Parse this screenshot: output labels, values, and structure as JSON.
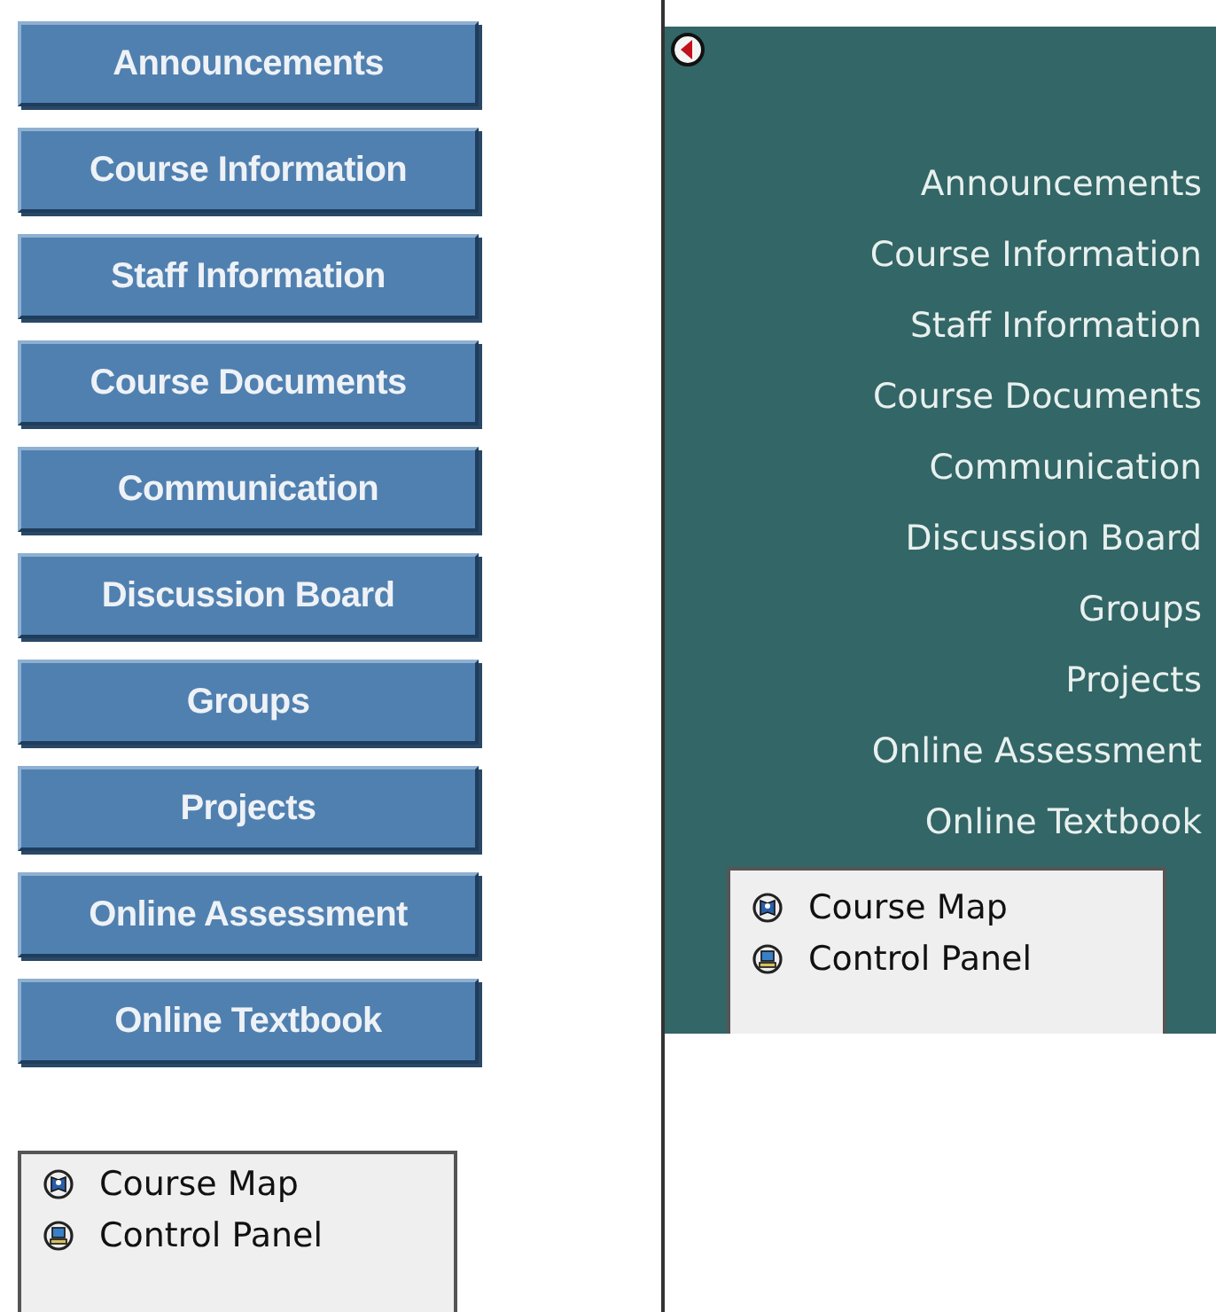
{
  "button_menu": {
    "buttons": [
      {
        "label": "Announcements"
      },
      {
        "label": "Course Information"
      },
      {
        "label": "Staff Information"
      },
      {
        "label": "Course Documents"
      },
      {
        "label": "Communication"
      },
      {
        "label": "Discussion Board"
      },
      {
        "label": "Groups"
      },
      {
        "label": "Projects"
      },
      {
        "label": "Online Assessment"
      },
      {
        "label": "Online Textbook"
      }
    ],
    "tools": [
      {
        "kind": "map",
        "label": "Course Map"
      },
      {
        "kind": "panel",
        "label": "Control Panel"
      }
    ]
  },
  "text_menu": {
    "links": [
      {
        "label": "Announcements"
      },
      {
        "label": "Course Information"
      },
      {
        "label": "Staff Information"
      },
      {
        "label": "Course Documents"
      },
      {
        "label": "Communication"
      },
      {
        "label": "Discussion Board"
      },
      {
        "label": "Groups"
      },
      {
        "label": "Projects"
      },
      {
        "label": "Online Assessment"
      },
      {
        "label": "Online Textbook"
      }
    ],
    "tools": [
      {
        "kind": "map",
        "label": "Course Map"
      },
      {
        "kind": "panel",
        "label": "Control Panel"
      }
    ]
  }
}
